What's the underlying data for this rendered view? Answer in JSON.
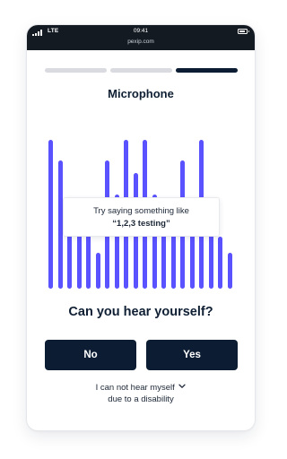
{
  "statusbar": {
    "carrier": "LTE",
    "time": "09:41",
    "url": "pexip.com",
    "signal_icon": "signal-icon",
    "battery_icon": "battery-icon"
  },
  "progress": {
    "steps_total": 3,
    "current_step": 3
  },
  "colors": {
    "accent": "#5a52ff",
    "primary_button": "#0c1d33",
    "progress_done": "#d9dbe0",
    "progress_active": "#0c1d33",
    "statusbar": "#131a22"
  },
  "title": "Microphone",
  "tooltip": {
    "line1": "Try saying something like",
    "line2": "“1,2,3 testing”"
  },
  "question": "Can you hear yourself?",
  "buttons": {
    "no": "No",
    "yes": "Yes"
  },
  "disability_link": {
    "line1": "I can not hear myself",
    "line2": "due to a disability",
    "icon": "chevron-down-icon"
  },
  "audio_levels": [
    1.0,
    0.86,
    0.58,
    0.45,
    0.4,
    0.24,
    0.86,
    0.63,
    1.0,
    0.78,
    1.0,
    0.63,
    0.55,
    0.45,
    0.86,
    0.55,
    1.0,
    0.55,
    0.35,
    0.24
  ]
}
